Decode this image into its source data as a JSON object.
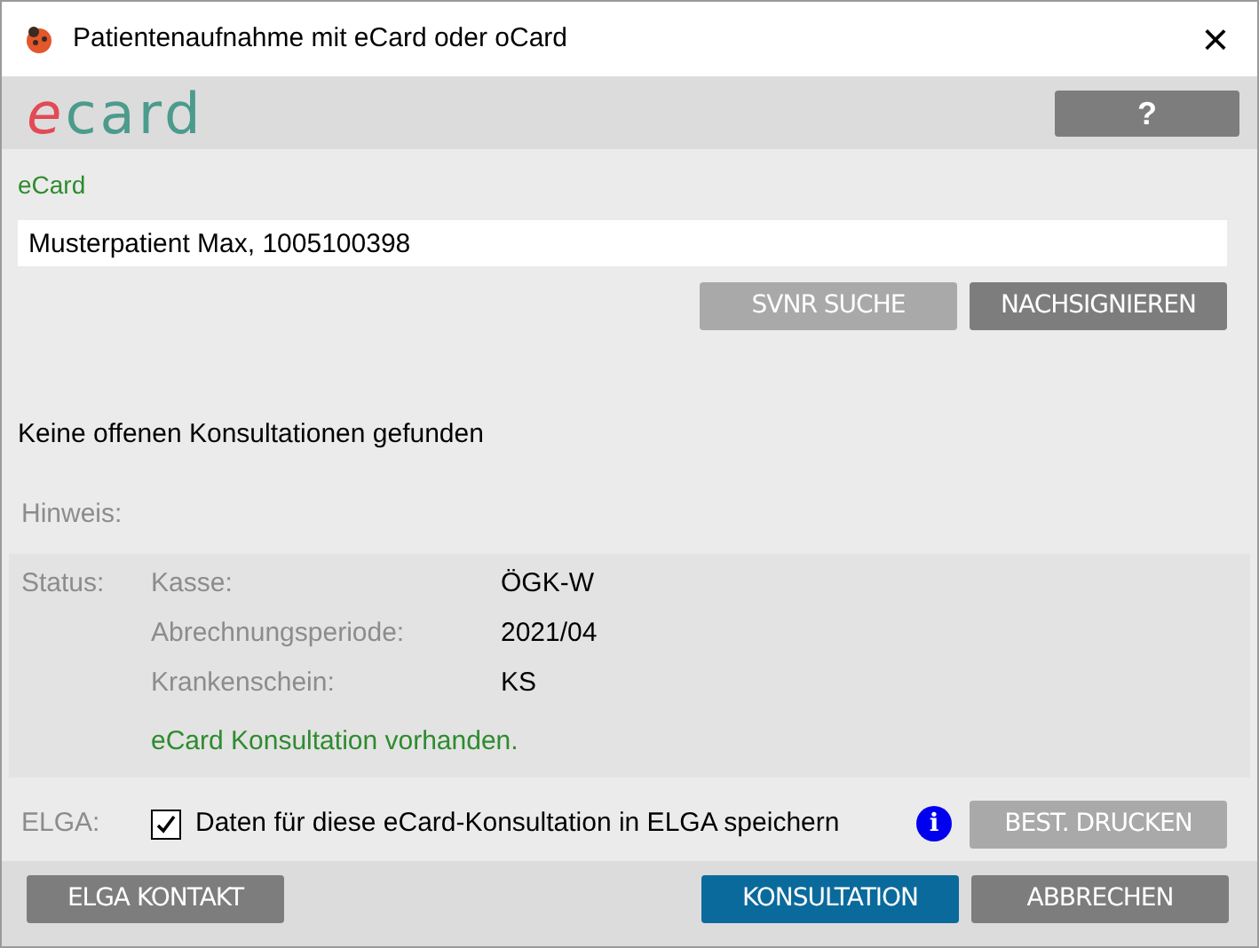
{
  "window": {
    "title": "Patientenaufnahme mit eCard oder oCard",
    "close": "×"
  },
  "header": {
    "logo_prefix": "e",
    "logo_rest": "card",
    "help_button": "?"
  },
  "card_section": {
    "label": "eCard",
    "field_value": "Musterpatient Max, 1005100398",
    "buttons": [
      {
        "label": "SVNR SUCHE",
        "disabled": true
      },
      {
        "label": "NACHSIGNIEREN",
        "disabled": false
      }
    ]
  },
  "message": "Keine offenen Konsultationen gefunden",
  "hint_label": "Hinweis:",
  "status": {
    "label": "Status:",
    "rows": [
      {
        "key": "Kasse:",
        "value": "ÖGK-W"
      },
      {
        "key": "Abrechnungsperiode:",
        "value": "2021/04"
      },
      {
        "key": "Krankenschein:",
        "value": "KS"
      }
    ],
    "note": "eCard Konsultation vorhanden."
  },
  "elga": {
    "label": "ELGA:",
    "checkbox": {
      "label": "Daten für diese eCard-Konsultation in ELGA speichern",
      "checked": true
    },
    "info": "i",
    "button": {
      "label": "BEST. DRUCKEN",
      "disabled": true
    }
  },
  "footer": {
    "left_button": {
      "label": "ELGA KONTAKT",
      "disabled": false
    },
    "right_buttons": [
      {
        "label": "KONSULTATION",
        "primary": true,
        "disabled": false
      },
      {
        "label": "ABBRECHEN",
        "primary": false,
        "disabled": false
      }
    ]
  }
}
